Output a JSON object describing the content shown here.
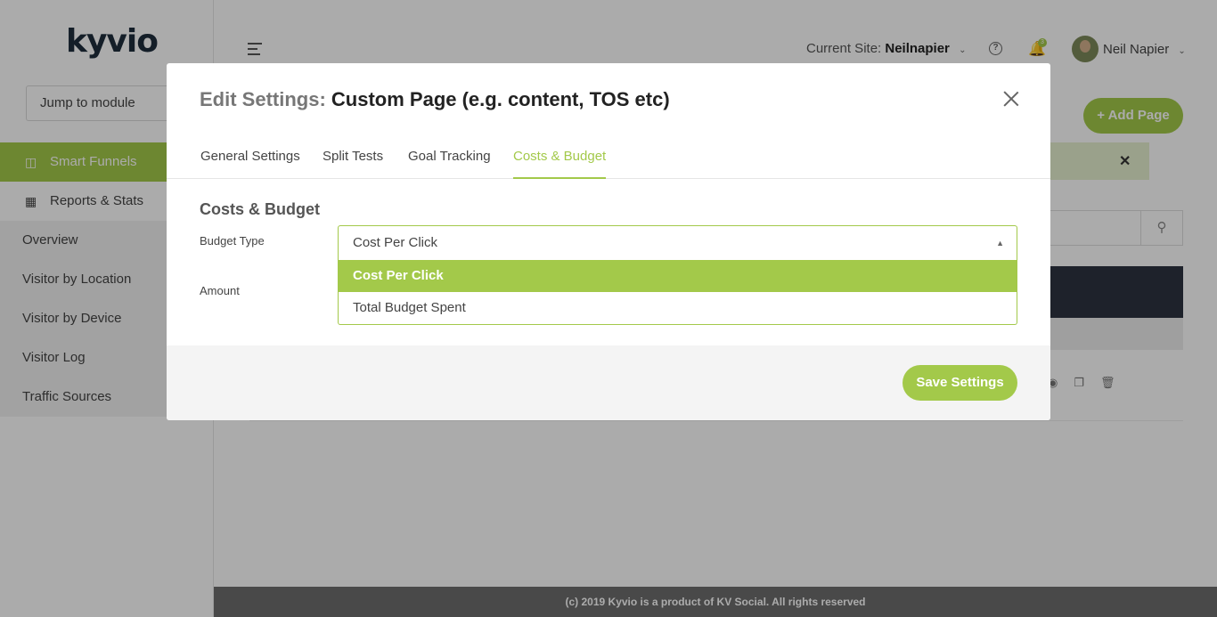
{
  "app": {
    "logo": "kyvio",
    "jump_module": "Jump to module",
    "sidebar": {
      "items": [
        {
          "label": "Smart Funnels",
          "active": true
        },
        {
          "label": "Reports & Stats",
          "active": false
        }
      ],
      "subitems": [
        "Overview",
        "Visitor by Location",
        "Visitor by Device",
        "Visitor Log",
        "Traffic Sources"
      ]
    },
    "topbar": {
      "current_site_label": "Current Site:",
      "current_site_value": "Neilnapier",
      "notification_count": "3",
      "user_name": "Neil Napier"
    },
    "add_page_button": "+ Add Page",
    "footer": "(c) 2019 Kyvio is a product of KV Social. All rights reserved"
  },
  "modal": {
    "title_prefix": "Edit Settings:",
    "title_main": "Custom Page (e.g. content, TOS etc)",
    "tabs": [
      {
        "label": "General Settings",
        "active": false
      },
      {
        "label": "Split Tests",
        "active": false
      },
      {
        "label": "Goal Tracking",
        "active": false
      },
      {
        "label": "Costs & Budget",
        "active": true
      }
    ],
    "section_title": "Costs & Budget",
    "budget_type_label": "Budget Type",
    "budget_type_value": "Cost Per Click",
    "amount_label": "Amount",
    "options": [
      {
        "label": "Cost Per Click",
        "selected": true
      },
      {
        "label": "Total Budget Spent",
        "selected": false
      }
    ],
    "save_button": "Save Settings"
  },
  "colors": {
    "accent": "#a3c94a",
    "overlay": "rgba(0,0,0,0.33)"
  }
}
